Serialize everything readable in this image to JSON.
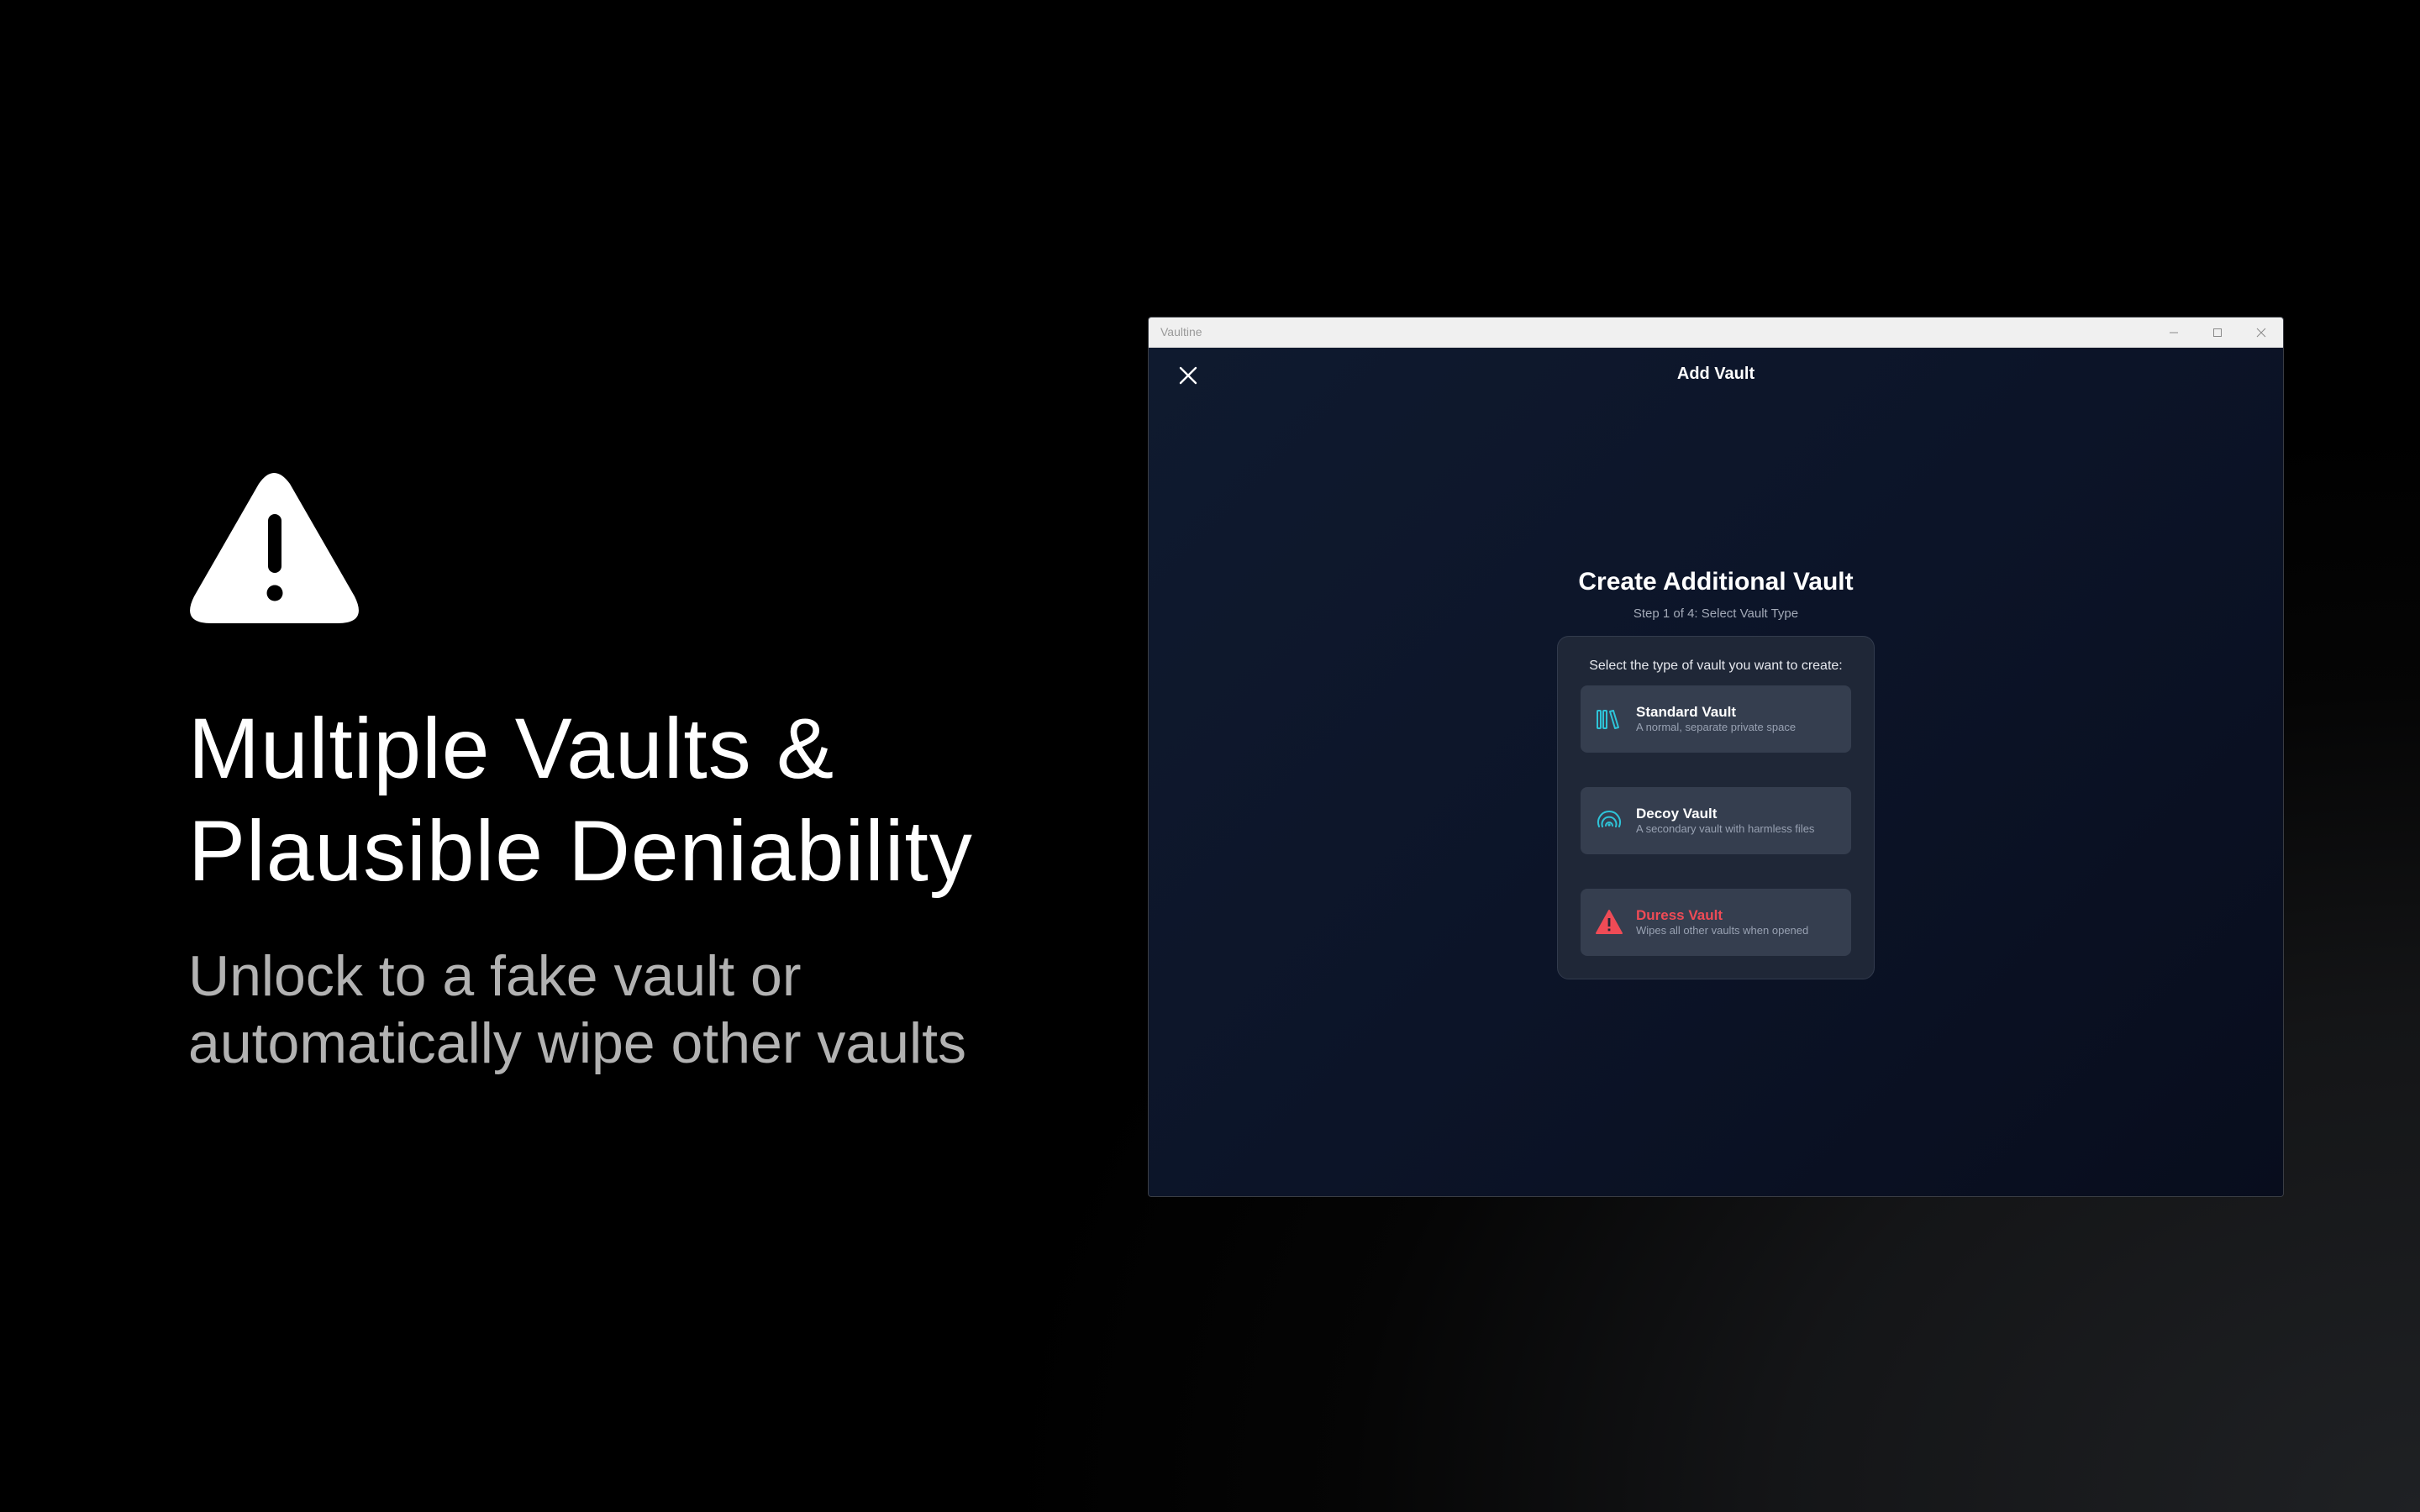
{
  "promo": {
    "icon": "warning-triangle-icon",
    "title_line1": "Multiple Vaults &",
    "title_line2": "Plausible Deniability",
    "subtitle_line1": "Unlock to a fake vault or",
    "subtitle_line2": "automatically wipe other vaults"
  },
  "window": {
    "title": "Vaultine",
    "controls": [
      "minimize-icon",
      "maximize-icon",
      "close-icon"
    ]
  },
  "app": {
    "header_title": "Add Vault",
    "close_icon": "close-icon",
    "main_title": "Create Additional Vault",
    "step_text": "Step 1 of 4: Select Vault Type",
    "prompt": "Select the type of vault you want to create:",
    "options": [
      {
        "icon": "books-icon",
        "title": "Standard Vault",
        "description": "A normal, separate private space",
        "accent": "#2ec4d8"
      },
      {
        "icon": "fingerprint-icon",
        "title": "Decoy Vault",
        "description": "A secondary vault with harmless files",
        "accent": "#2ec4d8"
      },
      {
        "icon": "warning-icon",
        "title": "Duress Vault",
        "description": "Wipes all other vaults when opened",
        "accent": "#ef4b56"
      }
    ]
  }
}
